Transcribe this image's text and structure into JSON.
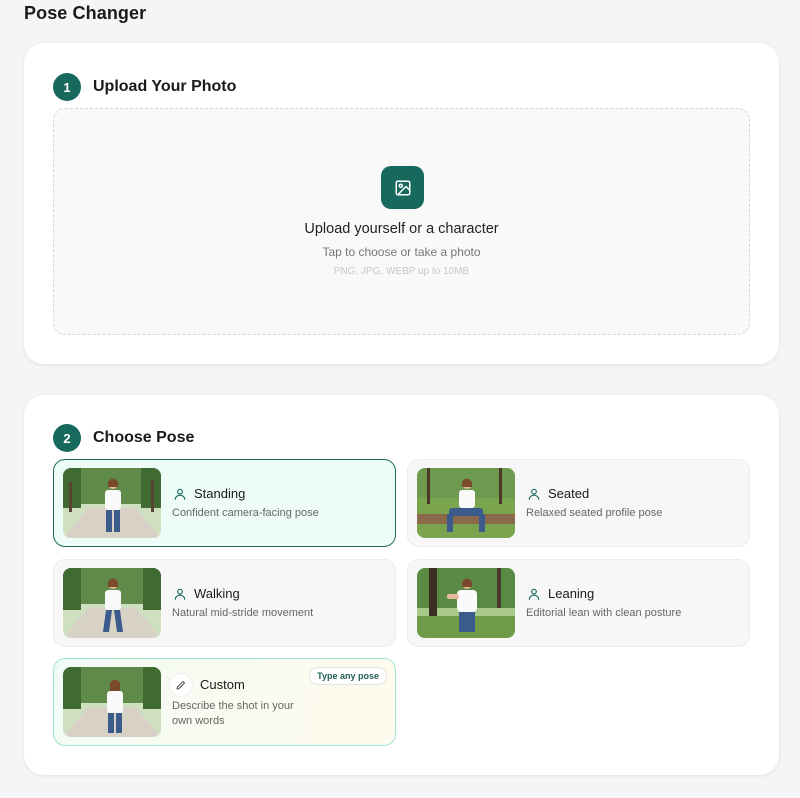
{
  "app": {
    "title": "Pose Changer"
  },
  "upload": {
    "step_number": "1",
    "heading": "Upload Your Photo",
    "title": "Upload yourself or a character",
    "subtitle": "Tap to choose or take a photo",
    "hint": "PNG, JPG, WEBP up to 10MB",
    "icon": "image-icon"
  },
  "pose": {
    "step_number": "2",
    "heading": "Choose Pose",
    "options": [
      {
        "title": "Standing",
        "description": "Confident camera-facing pose",
        "icon": "person-icon",
        "selected": true
      },
      {
        "title": "Seated",
        "description": "Relaxed seated profile pose",
        "icon": "person-icon",
        "selected": false
      },
      {
        "title": "Walking",
        "description": "Natural mid-stride movement",
        "icon": "person-icon",
        "selected": false
      },
      {
        "title": "Leaning",
        "description": "Editorial lean with clean posture",
        "icon": "person-icon",
        "selected": false
      },
      {
        "title": "Custom",
        "description": "Describe the shot in your own words",
        "icon": "pencil-icon",
        "badge": "Type any pose",
        "selected": false
      }
    ]
  },
  "colors": {
    "accent": "#17695e",
    "selected_bg": "#edfcf6",
    "custom_border": "#9de6d0"
  }
}
